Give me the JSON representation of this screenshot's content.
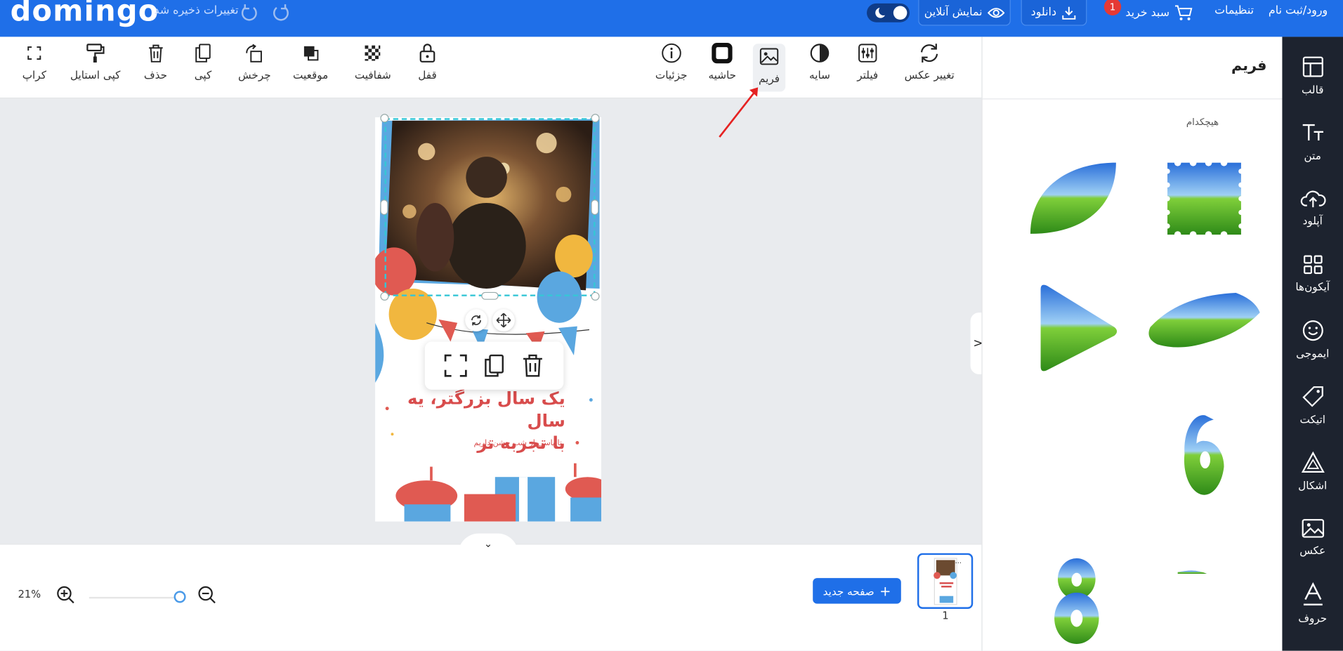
{
  "topbar": {
    "logo": "domingo",
    "saved_status": "تغییرات ذخیره شد",
    "preview_label": "نمایش آنلاین",
    "download_label": "دانلود",
    "cart_label": "سبد خرید",
    "cart_count": "1",
    "settings_label": "تنظیمات",
    "login_label": "ورود/ثبت نام",
    "brand_color": "#1f6fe8"
  },
  "toolbar": {
    "left_tools": [
      {
        "label": "کراپ",
        "icon": "crop-icon"
      },
      {
        "label": "کپی استایل",
        "icon": "paint-roller-icon"
      },
      {
        "label": "حذف",
        "icon": "trash-icon"
      },
      {
        "label": "کپی",
        "icon": "copy-icon"
      },
      {
        "label": "چرخش",
        "icon": "rotate-icon"
      },
      {
        "label": "موقعیت",
        "icon": "layers-icon"
      },
      {
        "label": "شفافیت",
        "icon": "transparency-icon"
      },
      {
        "label": "قفل",
        "icon": "lock-icon"
      }
    ],
    "right_tools": [
      {
        "label": "جزئیات",
        "icon": "info-icon"
      },
      {
        "label": "حاشیه",
        "icon": "border-icon"
      },
      {
        "label": "فریم",
        "icon": "frame-icon",
        "active": true
      },
      {
        "label": "سایه",
        "icon": "shadow-icon"
      },
      {
        "label": "فیلتر",
        "icon": "filter-icon"
      },
      {
        "label": "تغییر عکس",
        "icon": "replace-image-icon"
      }
    ]
  },
  "panel": {
    "title": "فریم",
    "none_label": "هیچکدام",
    "frames": [
      "leaf-frame",
      "stamp-frame",
      "triangle-frame",
      "brush-frame",
      "digit-6-frame",
      "digit-8-frame"
    ]
  },
  "sidenav": {
    "items": [
      {
        "label": "قالب",
        "icon": "template-icon"
      },
      {
        "label": "متن",
        "icon": "text-icon"
      },
      {
        "label": "آپلود",
        "icon": "upload-icon"
      },
      {
        "label": "آیکون‌ها",
        "icon": "grid-icon"
      },
      {
        "label": "ایموجی",
        "icon": "emoji-icon"
      },
      {
        "label": "اتیکت",
        "icon": "tag-icon"
      },
      {
        "label": "اشکال",
        "icon": "shapes-icon"
      },
      {
        "label": "عکس",
        "icon": "image-icon"
      },
      {
        "label": "حروف",
        "icon": "letters-icon"
      }
    ]
  },
  "canvas": {
    "headline_line1": "یک سال بزرگتر، یه سال",
    "headline_line2": "با تجربه تر",
    "subline": "تا پاسی از شب جشن داریم"
  },
  "bottom": {
    "zoom": "21%",
    "zoom_fraction": 0.21,
    "new_page_label": "صفحه جدید",
    "page_number": "1"
  }
}
